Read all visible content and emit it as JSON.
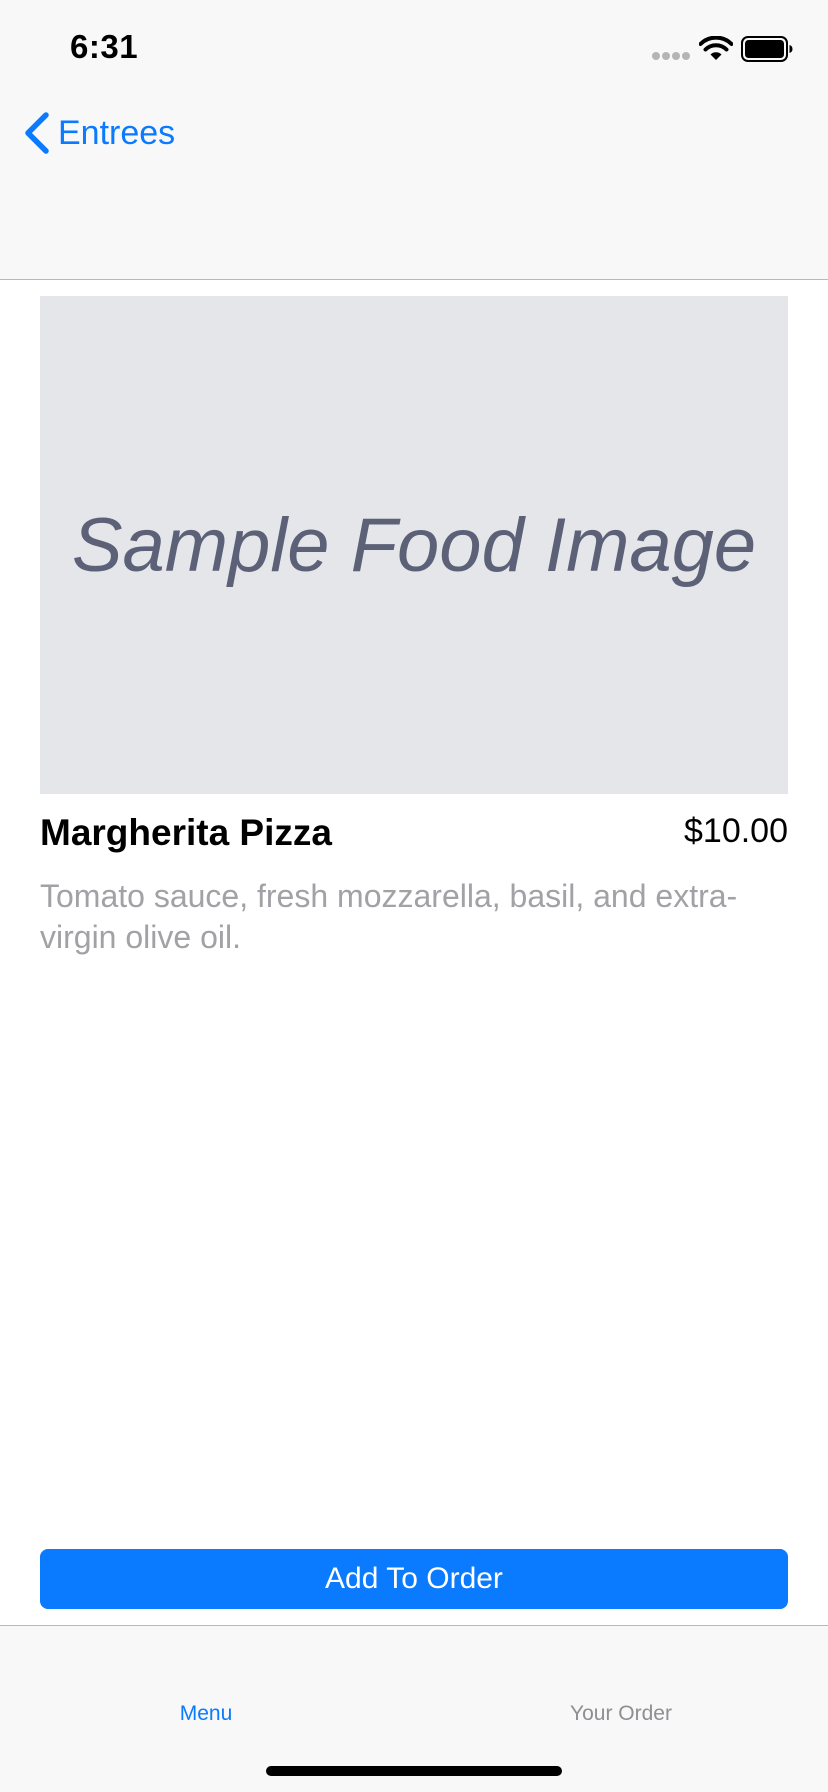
{
  "status_bar": {
    "time": "6:31",
    "icons": [
      "signal-dots-icon",
      "wifi-icon",
      "battery-icon"
    ]
  },
  "nav": {
    "back_label": "Entrees",
    "back_icon": "chevron-left-icon"
  },
  "item": {
    "image_placeholder": "Sample Food Image",
    "name": "Margherita Pizza",
    "price": "$10.00",
    "description": "Tomato sauce, fresh mozzarella, basil, and extra-virgin olive oil."
  },
  "actions": {
    "add_to_order_label": "Add To Order"
  },
  "tab_bar": {
    "tabs": [
      {
        "label": "Menu",
        "selected": true
      },
      {
        "label": "Your Order",
        "selected": false
      }
    ]
  },
  "colors": {
    "accent": "#0a7aff",
    "bar_background": "#f8f8f8",
    "image_background": "#e4e6e9",
    "secondary_text": "#a1a1a6",
    "inactive_tab": "#8e8e93"
  }
}
